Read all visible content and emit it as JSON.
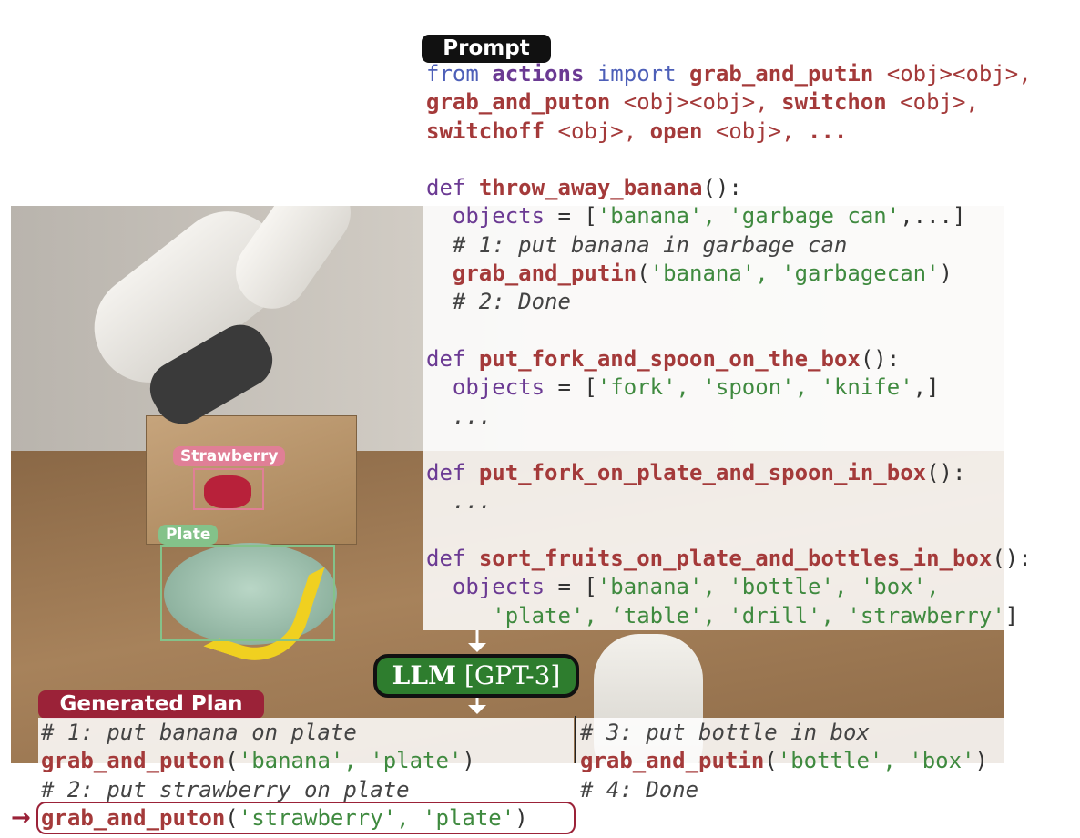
{
  "colors": {
    "prompt_tag_bg": "#111111",
    "plan_tag_bg": "#9b2238",
    "llm_bg": "#2e7d2e",
    "strawberry_box": "#e07f96",
    "plate_box": "#84c28a",
    "function_name": "#a43a3a",
    "string": "#3f8a3f",
    "keyword": "#4d5fb8"
  },
  "prompt_label": "Prompt",
  "prompt": {
    "import": {
      "from": "from",
      "module": "actions",
      "import": "import",
      "a1": "grab_and_putin",
      "a1_args": " <obj><obj>,",
      "a2": "grab_and_puton",
      "a2_args": " <obj><obj>, ",
      "a3": "switchon",
      "a3_args": " <obj>,",
      "a4": "switchoff",
      "a4_args": " <obj>, ",
      "a5": "open",
      "a5_args": " <obj>, ",
      "a6": "..."
    },
    "ex1": {
      "def": "def",
      "name": "throw_away_banana",
      "objects_var": "objects",
      "objects": "'banana', 'garbage can'",
      "objects_tail": ",...]",
      "comment1": "# 1: put banana in garbage can",
      "call": "grab_and_putin",
      "args": "'banana', 'garbagecan'",
      "comment2": "# 2: Done"
    },
    "ex2": {
      "def": "def",
      "name": "put_fork_and_spoon_on_the_box",
      "objects_var": "objects",
      "objects": "'fork', 'spoon', 'knife'",
      "objects_tail": ",]",
      "ellipsis": "..."
    },
    "ex3": {
      "def": "def",
      "name": "put_fork_on_plate_and_spoon_in_box",
      "ellipsis": "..."
    },
    "task": {
      "def": "def",
      "name": "sort_fruits_on_plate_and_bottles_in_box",
      "objects_var": "objects",
      "objects_line1": "'banana', 'bottle', 'box',",
      "objects_line2": "'plate', ‘table', 'drill', 'strawberry'",
      "objects_close": "]"
    }
  },
  "llm_label": {
    "bold": "LLM",
    "rest": " [GPT-3]"
  },
  "plan_label": "Generated Plan",
  "plan": {
    "step1_comment": "# 1: put banana on plate",
    "step1_fn": "grab_and_puton",
    "step1_args": "'banana', 'plate'",
    "step2_comment": "# 2: put strawberry on plate",
    "step2_fn": "grab_and_puton",
    "step2_args": "'strawberry', 'plate'",
    "step3_comment": "# 3: put bottle in box",
    "step3_fn": "grab_and_putin",
    "step3_args": "'bottle', 'box'",
    "step4_comment": "# 4: Done",
    "arrow": "→"
  },
  "detections": {
    "strawberry": "Strawberry",
    "plate": "Plate"
  }
}
